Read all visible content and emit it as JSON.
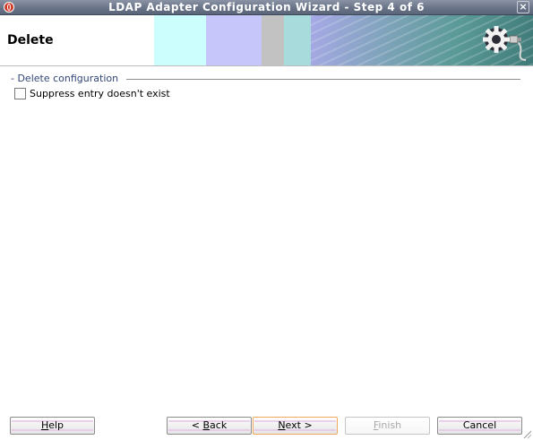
{
  "window": {
    "title": "LDAP Adapter Configuration Wizard - Step 4 of 6",
    "close_label": "×"
  },
  "header": {
    "title": "Delete"
  },
  "section": {
    "legend": "- Delete configuration",
    "checkbox_label": "Suppress entry doesn't exist",
    "checkbox_checked": false
  },
  "buttons": {
    "help": {
      "pre": "",
      "mnemonic": "H",
      "post": "elp"
    },
    "back": {
      "pre": "< ",
      "mnemonic": "B",
      "post": "ack"
    },
    "next": {
      "pre": "",
      "mnemonic": "N",
      "post": "ext >"
    },
    "finish": {
      "pre": "",
      "mnemonic": "F",
      "post": "inish",
      "enabled": false
    },
    "cancel": {
      "label": "Cancel"
    }
  },
  "colors": {
    "title_bar": "#6a7488",
    "section_text": "#33467a",
    "default_button_border": "#f0a85c"
  },
  "icons": [
    "app-logo-icon",
    "close-icon",
    "gear-plug-icon",
    "resize-grip-icon"
  ]
}
